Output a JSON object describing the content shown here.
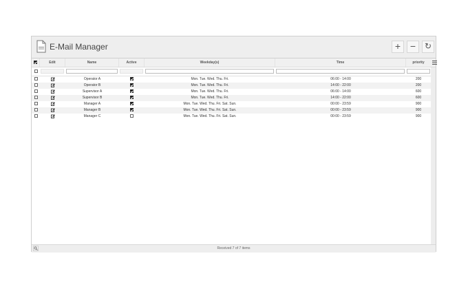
{
  "window": {
    "title": "E-Mail Manager"
  },
  "header_buttons": {
    "add": "+",
    "remove": "−",
    "refresh": "↻"
  },
  "columns": [
    "Edit",
    "Name",
    "Active",
    "Weekday(s)",
    "Time",
    "priority"
  ],
  "rows": [
    {
      "name": "Operator A",
      "active": true,
      "weekdays": "Mon. Tue. Wed. Thu. Fri.",
      "time": "06:00 - 14:00",
      "priority": "200"
    },
    {
      "name": "Operator B",
      "active": true,
      "weekdays": "Mon. Tue. Wed. Thu. Fri.",
      "time": "14:00 - 22:00",
      "priority": "200"
    },
    {
      "name": "Supervisor A",
      "active": true,
      "weekdays": "Mon. Tue. Wed. Thu. Fri.",
      "time": "06:00 - 14:00",
      "priority": "600"
    },
    {
      "name": "Supervisor B",
      "active": true,
      "weekdays": "Mon. Tue. Wed. Thu. Fri.",
      "time": "14:00 - 22:00",
      "priority": "600"
    },
    {
      "name": "Manager A",
      "active": true,
      "weekdays": "Mon. Tue. Wed. Thu. Fri. Sat. Sun.",
      "time": "00:00 - 23:59",
      "priority": "900"
    },
    {
      "name": "Manager B",
      "active": true,
      "weekdays": "Mon. Tue. Wed. Thu. Fri. Sat. Sun.",
      "time": "00:00 - 23:59",
      "priority": "900"
    },
    {
      "name": "Manager C",
      "active": false,
      "weekdays": "Mon. Tue. Wed. Thu. Fri. Sat. Sun.",
      "time": "00:00 - 23:59",
      "priority": "900"
    }
  ],
  "footer": {
    "status": "Received 7 of 7 items"
  },
  "icons": {
    "app": "document-icon",
    "edit": "edit-icon",
    "search": "search-icon",
    "menu": "menu-icon"
  }
}
